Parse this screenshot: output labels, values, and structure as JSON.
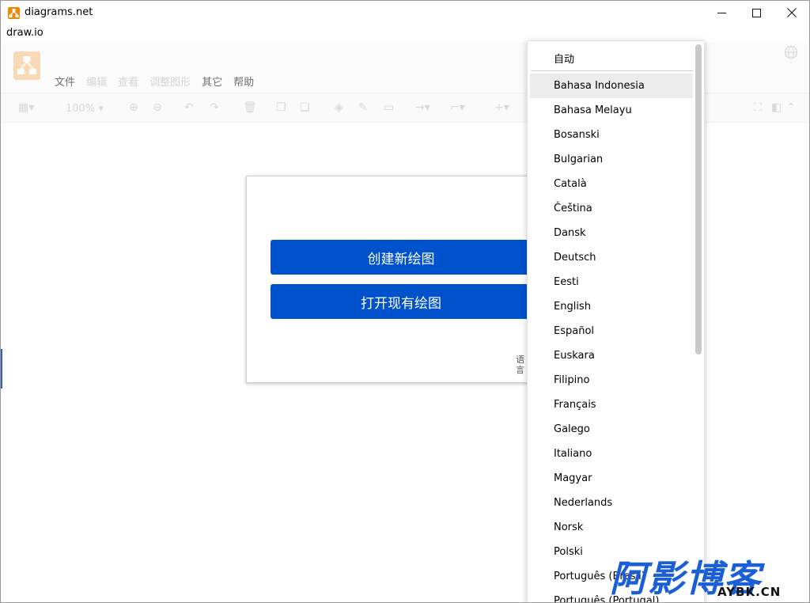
{
  "window": {
    "title": "diagrams.net",
    "menubar_label": "draw.io",
    "controls": {
      "minimize": "—",
      "maximize": "☐",
      "close": "✕"
    }
  },
  "app": {
    "menus": [
      "文件",
      "编辑",
      "查看",
      "调整图形",
      "其它",
      "帮助"
    ],
    "zoom_label": "100%"
  },
  "dialog": {
    "create_button": "创建新绘图",
    "open_button": "打开现有绘图",
    "language_link": "语言"
  },
  "language_menu": {
    "auto": "自动",
    "items": [
      "Bahasa Indonesia",
      "Bahasa Melayu",
      "Bosanski",
      "Bulgarian",
      "Català",
      "Čeština",
      "Dansk",
      "Deutsch",
      "Eesti",
      "English",
      "Español",
      "Euskara",
      "Filipino",
      "Français",
      "Galego",
      "Italiano",
      "Magyar",
      "Nederlands",
      "Norsk",
      "Polski",
      "Português (Brasil)",
      "Português (Portugal)"
    ],
    "highlighted": "Bahasa Indonesia"
  },
  "watermark": {
    "main": "阿影博客",
    "sub": "AYBK.CN"
  },
  "colors": {
    "primary_button": "#0052cc",
    "app_icon": "#f08705",
    "watermark": "#1a5fd6"
  }
}
